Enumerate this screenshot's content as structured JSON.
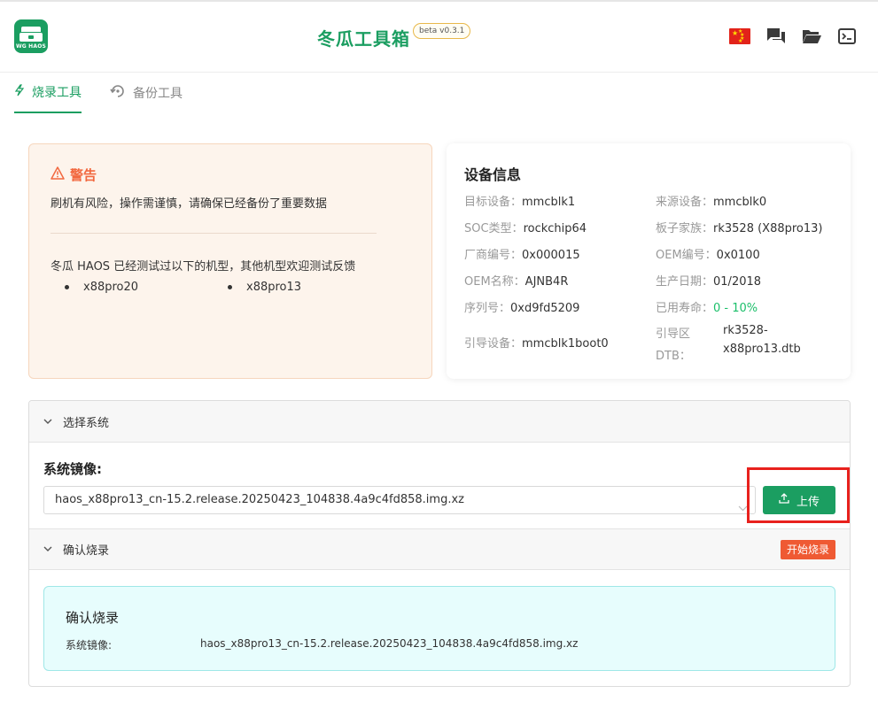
{
  "header": {
    "logo_text": "WG HAOS",
    "title": "冬瓜工具箱",
    "badge": "beta v0.3.1"
  },
  "tabs": [
    {
      "label": "烧录工具",
      "active": true
    },
    {
      "label": "备份工具",
      "active": false
    }
  ],
  "warning": {
    "title": "警告",
    "text": "刷机有风险，操作需谨慎，请确保已经备份了重要数据",
    "tested_text": "冬瓜 HAOS 已经测试过以下的机型，其他机型欢迎测试反馈",
    "models": [
      "x88pro20",
      "x88pro13"
    ]
  },
  "device": {
    "title": "设备信息",
    "fields": [
      {
        "label": "目标设备：",
        "value": "mmcblk1"
      },
      {
        "label": "来源设备：",
        "value": "mmcblk0"
      },
      {
        "label": "SOC类型：",
        "value": "rockchip64"
      },
      {
        "label": "板子家族：",
        "value": "rk3528 (X88pro13)"
      },
      {
        "label": "厂商编号：",
        "value": "0x000015"
      },
      {
        "label": "OEM编号：",
        "value": "0x0100"
      },
      {
        "label": "OEM名称：",
        "value": "AJNB4R"
      },
      {
        "label": "生产日期：",
        "value": "01/2018"
      },
      {
        "label": "序列号：",
        "value": "0xd9fd5209"
      },
      {
        "label": "已用寿命：",
        "value": "0 - 10%"
      },
      {
        "label": "引导设备：",
        "value": "mmcblk1boot0"
      },
      {
        "label_line1": "引导区",
        "label_line2": "DTB：",
        "value_line1": "rk3528-",
        "value_line2": "x88pro13.dtb"
      }
    ]
  },
  "select_system": {
    "header": "选择系统",
    "image_label": "系统镜像:",
    "selected_image": "haos_x88pro13_cn-15.2.release.20250423_104838.4a9c4fd858.img.xz",
    "upload_label": "上传"
  },
  "confirm": {
    "header": "确认烧录",
    "start_label": "开始烧录",
    "box_title": "确认烧录",
    "image_label": "系统镜像:",
    "image_value": "haos_x88pro13_cn-15.2.release.20250423_104838.4a9c4fd858.img.xz"
  },
  "colors": {
    "accent": "#1b9e61",
    "warning": "#f2683f",
    "danger_button": "#ef5a33",
    "life_value": "#1bbf6a"
  },
  "icons": [
    "logo-icon",
    "china-flag-icon",
    "chat-icon",
    "folder-icon",
    "terminal-icon",
    "lightning-icon",
    "backup-restore-icon",
    "warning-triangle-icon",
    "chevron-down-icon",
    "upload-icon"
  ]
}
